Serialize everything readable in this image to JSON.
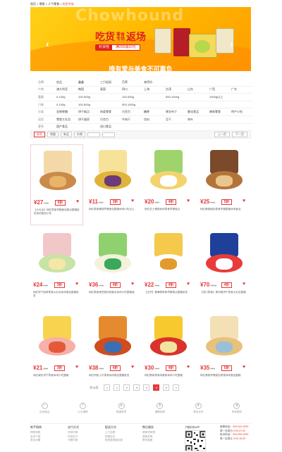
{
  "breadcrumb": {
    "home": "首页",
    "sep1": " > ",
    "c1": "零食",
    "sep2": " > ",
    "c2": "人气零食",
    "sep3": " > ",
    "current": "吃货专场"
  },
  "banner": {
    "bg_word": "Chowhound",
    "title_left": "吃货",
    "title_mid_top": "零食",
    "title_mid_bottom": "专场",
    "title_right": "返场",
    "coupon_left": "补货啦",
    "coupon_right": "满200减10元",
    "slogan": "唯有爱与美食不可辜负"
  },
  "filters": [
    {
      "label": "品牌",
      "options": [
        "良品",
        "鑫鑫",
        "三只松鼠",
        "百草",
        "来伊份",
        "",
        "",
        "",
        ""
      ]
    },
    {
      "label": "产地",
      "options": [
        "澳大利亚",
        "韩国",
        "泰国",
        "四川",
        "上海",
        "台湾",
        "山东",
        "广西",
        "广东"
      ]
    },
    {
      "label": "重量",
      "options": [
        "0-100g",
        "100-500g",
        "",
        "100-500g",
        "",
        "500-1000g",
        "",
        "1000g以上",
        ""
      ]
    },
    {
      "label": "口味",
      "options": [
        "0-100g",
        "100-500g",
        "",
        "500-1000g",
        "",
        "",
        "",
        "",
        ""
      ]
    },
    {
      "label": "分类",
      "options": [
        "坚果果脯",
        "饼干糕点",
        "肉类零食",
        "巧克力",
        "糖果",
        "果冻布丁",
        "膨化食品",
        "辣味零食",
        "特产小吃"
      ]
    },
    {
      "label": "适用",
      "options": [
        "零食大礼包",
        "饼干曲奇",
        "巧克力",
        "牛肉干",
        "饮料",
        "豆干",
        "茶叶",
        "",
        ""
      ]
    },
    {
      "label": "更多",
      "options": [
        "国产食品",
        "",
        "进口食品",
        "",
        "",
        "",
        "",
        "",
        ""
      ]
    }
  ],
  "toolbar": {
    "sort_default": "综合",
    "sort_sales": "销量",
    "sort_new": "新品",
    "sort_price": "价格",
    "prev": "上一页",
    "next": "下一页"
  },
  "products": [
    {
      "price": "¥27",
      "old": "¥59",
      "discount": "6折",
      "desc": "【大礼包】网红零食早餐面包糕点整箱批发休闲食品小吃"
    },
    {
      "price": "¥11",
      "old": "¥36",
      "discount": "3折",
      "desc": "网红零食蛋糕早餐面包整箱休闲小吃点心"
    },
    {
      "price": "¥20",
      "old": "¥50",
      "discount": "4折",
      "desc": "网红芝士蛋糕休闲零食早餐糕点"
    },
    {
      "price": "¥25",
      "old": "¥48",
      "discount": "5折",
      "desc": "网红蛋糕面包零食早餐整箱休闲食品"
    },
    {
      "price": "¥24",
      "old": "¥90",
      "discount": "3折",
      "desc": "网红饼干曲奇零食大礼包休闲食品整箱批发"
    },
    {
      "price": "¥36",
      "old": "¥99",
      "discount": "4折",
      "desc": "网红零食绿豆糕传统糕点休闲小吃整箱装"
    },
    {
      "price": "¥22",
      "old": "¥55",
      "discount": "4折",
      "desc": "【正宗】蛋黄酥零食早餐糕点整箱批发"
    },
    {
      "price": "¥70",
      "old": "¥195",
      "discount": "4折",
      "desc": "【进口零食】奥利奥饼干零食大礼包整箱"
    },
    {
      "price": "¥21",
      "old": "¥52",
      "discount": "3折",
      "desc": "网红威化饼干零食休闲小吃整箱"
    },
    {
      "price": "¥38",
      "old": "¥95",
      "discount": "4折",
      "desc": "网红肉松小贝零食休闲食品整箱批发"
    },
    {
      "price": "¥30",
      "old": "¥75",
      "discount": "4折",
      "desc": "网红蛋卷零食鸡蛋卷休闲小吃整箱"
    },
    {
      "price": "¥35",
      "old": "¥70",
      "discount": "5折",
      "desc": "网红蛋糕早餐面包零食休闲食品整箱"
    }
  ],
  "pagination": {
    "total": "共15页",
    "prev": "<",
    "pages": [
      "1",
      "2",
      "3",
      "4",
      "5",
      "6"
    ],
    "next": ">",
    "current": "5"
  },
  "services": [
    "正品保证",
    "七天退换",
    "极速发货",
    "满额包邮",
    "售后无忧",
    "特色服务"
  ],
  "footer": {
    "cols": [
      {
        "head": "新手指南",
        "items": [
          "购物流程",
          "会员介绍",
          "常见问题"
        ]
      },
      {
        "head": "支付方式",
        "items": [
          "货到付款",
          "在线支付",
          "分期付款"
        ]
      },
      {
        "head": "配送方式",
        "items": [
          "上门自提",
          "快速送达",
          "配送费收取标准"
        ]
      },
      {
        "head": "售后服务",
        "items": [
          "退换货政策",
          "退款说明",
          "联系客服"
        ]
      }
    ],
    "qr_caption": "下载手机APP",
    "contact": [
      {
        "k": "客服电话：",
        "v": "400-000-0000"
      },
      {
        "k": "周一至周日 ",
        "v": "9:00-21:00"
      },
      {
        "k": "投诉电话：",
        "v": "400-000-0000"
      },
      {
        "k": "周一至周五 ",
        "v": "9:00-18:00"
      }
    ]
  },
  "colors": {
    "accent": "#e4393c",
    "banner": "#ffbb00"
  }
}
